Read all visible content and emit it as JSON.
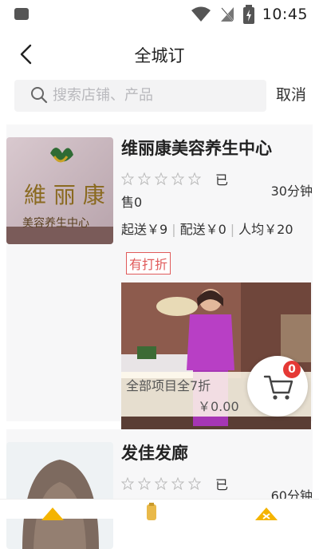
{
  "status_bar": {
    "time": "10:45"
  },
  "header": {
    "title": "全城订"
  },
  "search": {
    "placeholder": "搜索店铺、产品",
    "cancel_label": "取消"
  },
  "shops": [
    {
      "name": "维丽康美容养生中心",
      "rating": 0,
      "sold_label": "已售0",
      "delivery_time": "30分钟",
      "min_order": "起送￥9",
      "delivery_fee": "配送￥0",
      "avg_price": "人均￥20",
      "discount_badge": "有打折",
      "promo": {
        "text": "全部项目全7折",
        "price": "￥0.00"
      }
    },
    {
      "name": "发佳发廊",
      "rating": 0,
      "sold_label": "已",
      "delivery_time": "60分钟"
    }
  ],
  "cart": {
    "count": "0"
  },
  "colors": {
    "accent_red": "#e53935",
    "badge_red": "#e05a5a",
    "nav_yellow": "#f4b400"
  },
  "icons": {
    "back": "chevron-left-icon",
    "search": "search-icon",
    "cart": "shopping-cart-icon",
    "star": "star-outline-icon"
  }
}
